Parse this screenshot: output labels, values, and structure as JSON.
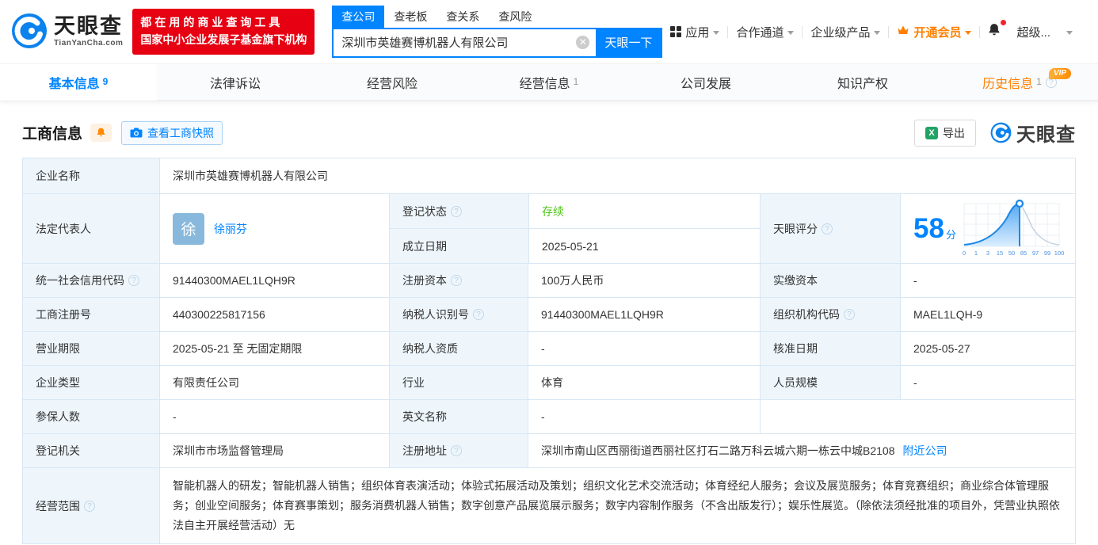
{
  "header": {
    "logo": {
      "title": "天眼查",
      "subtitle": "TianYanCha.com"
    },
    "promo": {
      "line1": "都在用的商业查询工具",
      "line2": "国家中小企业发展子基金旗下机构"
    },
    "search": {
      "tabs": [
        {
          "label": "查公司"
        },
        {
          "label": "查老板"
        },
        {
          "label": "查关系"
        },
        {
          "label": "查风险"
        }
      ],
      "value": "深圳市英雄赛博机器人有限公司",
      "button": "天眼一下"
    },
    "menu": {
      "apps": "应用",
      "partner": "合作通道",
      "enterprise": "企业级产品",
      "vip": "开通会员",
      "super": "超级..."
    }
  },
  "nav": {
    "vip_badge": "VIP",
    "tabs": [
      {
        "label": "基本信息",
        "count": "9"
      },
      {
        "label": "法律诉讼",
        "count": ""
      },
      {
        "label": "经营风险",
        "count": ""
      },
      {
        "label": "经营信息",
        "count": "1"
      },
      {
        "label": "公司发展",
        "count": ""
      },
      {
        "label": "知识产权",
        "count": ""
      },
      {
        "label": "历史信息",
        "count": "1"
      }
    ]
  },
  "section": {
    "title": "工商信息",
    "snapshot_button": "查看工商快照",
    "export_button": "导出",
    "watermark": "天眼查"
  },
  "company": {
    "name_label": "企业名称",
    "name": "深圳市英雄赛博机器人有限公司",
    "legal_rep_label": "法定代表人",
    "legal_rep_avatar": "徐",
    "legal_rep": "徐丽芬",
    "reg_status_label": "登记状态",
    "reg_status": "存续",
    "establish_label": "成立日期",
    "establish_date": "2025-05-21",
    "score_label": "天眼评分",
    "score": "58",
    "score_unit": "分",
    "score_axis": [
      "0",
      "1",
      "3",
      "15",
      "50",
      "85",
      "97",
      "99",
      "100"
    ],
    "credit_code_label": "统一社会信用代码",
    "credit_code": "91440300MAEL1LQH9R",
    "reg_capital_label": "注册资本",
    "reg_capital": "100万人民币",
    "paid_capital_label": "实缴资本",
    "paid_capital": "-",
    "reg_number_label": "工商注册号",
    "reg_number": "440300225817156",
    "taxpayer_id_label": "纳税人识别号",
    "taxpayer_id": "91440300MAEL1LQH9R",
    "org_code_label": "组织机构代码",
    "org_code": "MAEL1LQH-9",
    "term_label": "营业期限",
    "term": "2025-05-21 至 无固定期限",
    "taxpayer_quality_label": "纳税人资质",
    "taxpayer_quality": "-",
    "approval_date_label": "核准日期",
    "approval_date": "2025-05-27",
    "company_type_label": "企业类型",
    "company_type": "有限责任公司",
    "industry_label": "行业",
    "industry": "体育",
    "staff_size_label": "人员规模",
    "staff_size": "-",
    "insured_label": "参保人数",
    "insured": "-",
    "english_name_label": "英文名称",
    "english_name": "-",
    "registry_label": "登记机关",
    "registry": "深圳市市场监督管理局",
    "address_label": "注册地址",
    "address": "深圳市南山区西丽街道西丽社区打石二路万科云城六期一栋云中城B2108",
    "nearby_link": "附近公司",
    "scope_label": "经营范围",
    "scope": "智能机器人的研发；智能机器人销售；组织体育表演活动；体验式拓展活动及策划；组织文化艺术交流活动；体育经纪人服务；会议及展览服务；体育竞赛组织；商业综合体管理服务；创业空间服务；体育赛事策划；服务消费机器人销售；数字创意产品展览展示服务；数字内容制作服务（不含出版发行）；娱乐性展览。（除依法须经批准的项目外，凭营业执照依法自主开展经营活动）无"
  }
}
